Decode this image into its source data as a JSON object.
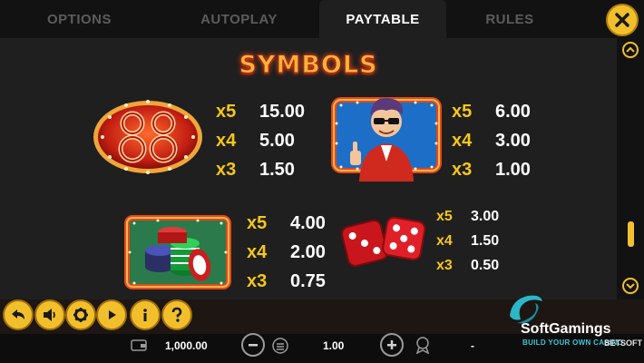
{
  "tabs": [
    {
      "label": "OPTIONS"
    },
    {
      "label": "AUTOPLAY"
    },
    {
      "label": "PAYTABLE"
    },
    {
      "label": "RULES"
    }
  ],
  "active_tab": "PAYTABLE",
  "title": "SYMBOLS",
  "symbols": [
    {
      "icon": "lucky-88-icon",
      "pays": [
        {
          "mult": "x5",
          "value": "15.00"
        },
        {
          "mult": "x4",
          "value": "5.00"
        },
        {
          "mult": "x3",
          "value": "1.50"
        }
      ]
    },
    {
      "icon": "gambler-man-icon",
      "pays": [
        {
          "mult": "x5",
          "value": "6.00"
        },
        {
          "mult": "x4",
          "value": "3.00"
        },
        {
          "mult": "x3",
          "value": "1.00"
        }
      ]
    },
    {
      "icon": "casino-chips-icon",
      "pays": [
        {
          "mult": "x5",
          "value": "4.00"
        },
        {
          "mult": "x4",
          "value": "2.00"
        },
        {
          "mult": "x3",
          "value": "0.75"
        }
      ]
    },
    {
      "icon": "dice-icon",
      "pays": [
        {
          "mult": "x5",
          "value": "3.00"
        },
        {
          "mult": "x4",
          "value": "1.50"
        },
        {
          "mult": "x3",
          "value": "0.50"
        }
      ]
    }
  ],
  "controls": [
    "back-icon",
    "sound-icon",
    "settings-icon",
    "play-icon",
    "info-icon",
    "help-icon"
  ],
  "status": {
    "balance": "1,000.00",
    "bet": "1.00",
    "win": "-"
  },
  "brand": {
    "name": "SoftGamings",
    "tagline": "BUILD YOUR OWN CASINO",
    "suffix": "BETSOFT"
  },
  "colors": {
    "accent": "#f2bf2c",
    "background": "#1f1f1f",
    "multiplier": "#f5c71a"
  }
}
